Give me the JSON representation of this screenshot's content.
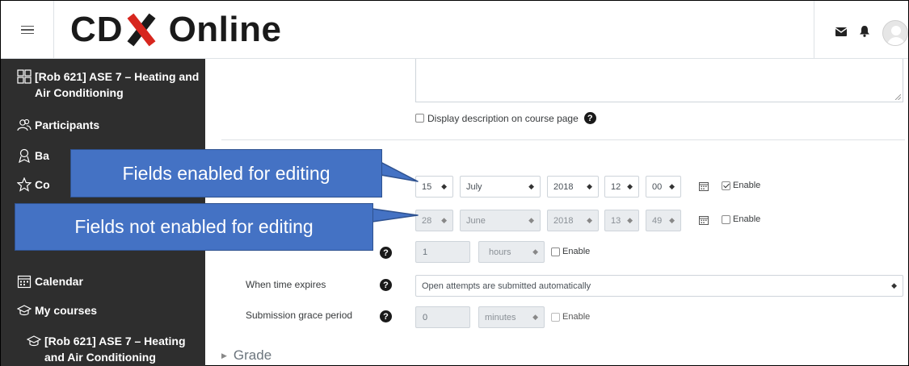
{
  "header": {
    "brand_left": "CDX",
    "brand_right": "Online",
    "icons": [
      "menu-icon",
      "mail-icon",
      "bell-icon",
      "avatar-icon"
    ],
    "brand_red": "#d7261e"
  },
  "sidebar": {
    "background": "#2e2e2e",
    "items": [
      {
        "icon": "course-grid-icon",
        "label": "[Rob 621] ASE 7 – Heating and",
        "label2": "Air Conditioning"
      },
      {
        "icon": "participants-icon",
        "label": "Participants"
      },
      {
        "icon": "badges-icon",
        "label": "Ba"
      },
      {
        "icon": "star-icon",
        "label": "Co"
      },
      {
        "icon": "calendar-icon",
        "label": "Calendar"
      },
      {
        "icon": "graduation-cap-icon",
        "label": "My courses"
      },
      {
        "icon": "graduation-cap-icon",
        "label": "[Rob 621] ASE 7 – Heating",
        "label2": "and Air Conditioning"
      }
    ]
  },
  "form": {
    "display_description_label": "Display description on course page",
    "open_date": {
      "day": "15",
      "month": "July",
      "year": "2018",
      "hour": "12",
      "minute": "00",
      "enable_label": "Enable",
      "enabled": true
    },
    "close_date": {
      "day": "28",
      "month": "June",
      "year": "2018",
      "hour": "13",
      "minute": "49",
      "enable_label": "Enable",
      "enabled": false
    },
    "time_limit": {
      "value": "1",
      "unit": "hours",
      "enable_label": "Enable"
    },
    "when_time_expires": {
      "label": "When time expires",
      "value": "Open attempts are submitted automatically"
    },
    "grace_period": {
      "label": "Submission grace period",
      "value": "0",
      "unit": "minutes",
      "enable_label": "Enable"
    },
    "grade_section": "Grade"
  },
  "callouts": {
    "enabled": "Fields enabled for editing",
    "not_enabled": "Fields not enabled for editing",
    "color": "#4472c4"
  }
}
